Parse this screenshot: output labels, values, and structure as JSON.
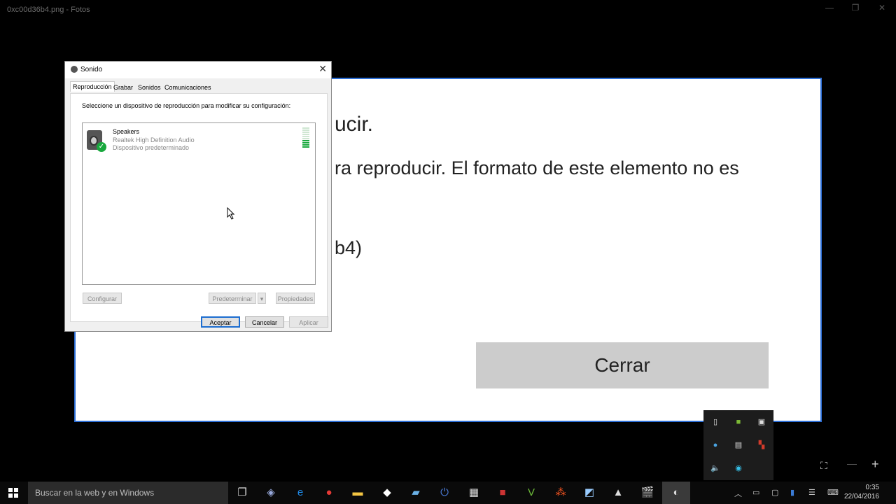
{
  "app": {
    "window_title": "0xc00d36b4.png - Fotos",
    "error": {
      "title_fragment": "ucir.",
      "message_fragment": "ra reproducir. El formato de este elemento no es",
      "code_fragment": "b4)",
      "close_button": "Cerrar"
    }
  },
  "dialog": {
    "title": "Sonido",
    "close": "✕",
    "tabs": [
      "Reproducción",
      "Grabar",
      "Sonidos",
      "Comunicaciones"
    ],
    "instruction": "Seleccione un dispositivo de reproducción para modificar su configuración:",
    "device": {
      "name": "Speakers",
      "driver": "Realtek High Definition Audio",
      "status": "Dispositivo predeterminado",
      "level": 0.4
    },
    "buttons": {
      "configure": "Configurar",
      "set_default": "Predeterminar",
      "properties": "Propiedades",
      "ok": "Aceptar",
      "cancel": "Cancelar",
      "apply": "Aplicar"
    }
  },
  "taskbar": {
    "search_placeholder": "Buscar en la web y en Windows",
    "time": "0:35",
    "date": "22/04/2016"
  }
}
